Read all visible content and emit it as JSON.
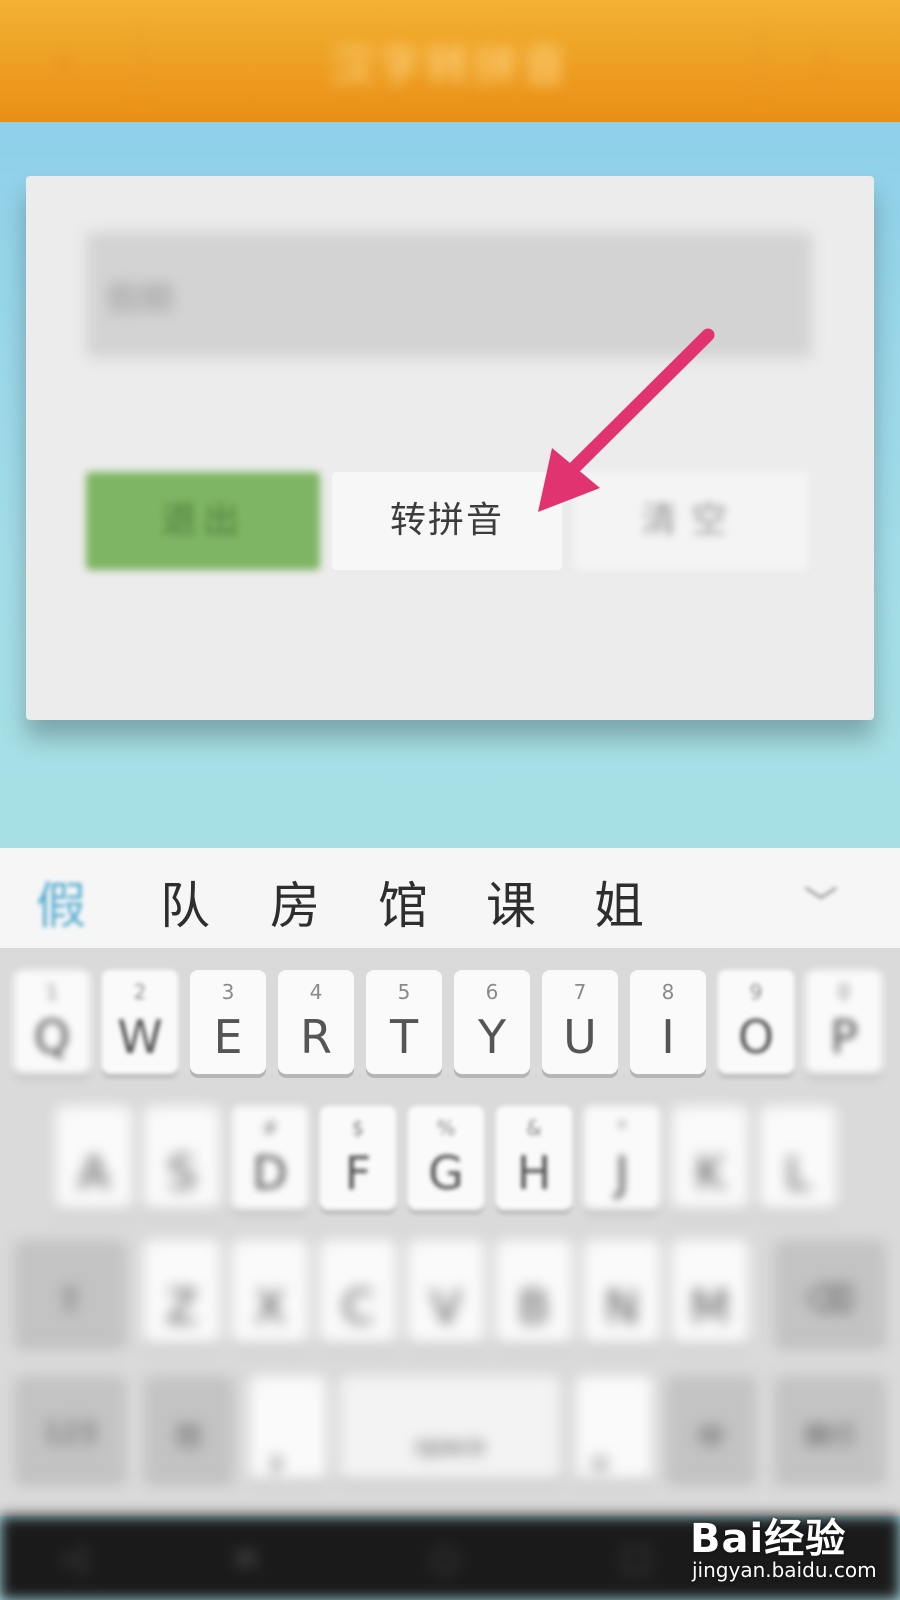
{
  "colors": {
    "topbar": "#ea8f15",
    "background": "#a9dde6",
    "exit_button": "#7db562",
    "arrow": "#e0336f",
    "candidate_highlight": "#5aaed1"
  },
  "app": {
    "title": "汉字转拼音",
    "back_icon": "back-arrow-icon",
    "menu_icon": "menu-icon"
  },
  "card": {
    "input_value": "假期",
    "buttons": {
      "exit": "退出",
      "to_pinyin": "转拼音",
      "clear": "清空"
    }
  },
  "ime": {
    "candidates": [
      "假",
      "队",
      "房",
      "馆",
      "课",
      "姐"
    ],
    "expand_icon": "chevron-down-icon"
  },
  "keyboard": {
    "row1": [
      {
        "num": "1",
        "letter": "Q"
      },
      {
        "num": "2",
        "letter": "W"
      },
      {
        "num": "3",
        "letter": "E"
      },
      {
        "num": "4",
        "letter": "R"
      },
      {
        "num": "5",
        "letter": "T"
      },
      {
        "num": "6",
        "letter": "Y"
      },
      {
        "num": "7",
        "letter": "U"
      },
      {
        "num": "8",
        "letter": "I"
      },
      {
        "num": "9",
        "letter": "O"
      },
      {
        "num": "0",
        "letter": "P"
      }
    ],
    "row2": [
      {
        "num": "",
        "letter": "A"
      },
      {
        "num": "",
        "letter": "S"
      },
      {
        "num": "#",
        "letter": "D"
      },
      {
        "num": "$",
        "letter": "F"
      },
      {
        "num": "%",
        "letter": "G"
      },
      {
        "num": "&",
        "letter": "H"
      },
      {
        "num": "*",
        "letter": "J"
      },
      {
        "num": "",
        "letter": "K"
      },
      {
        "num": "",
        "letter": "L"
      }
    ],
    "row3": [
      "Z",
      "X",
      "C",
      "V",
      "B",
      "N",
      "M"
    ],
    "row4": [
      "123",
      "符",
      "，",
      "space",
      "。",
      "中",
      "换行"
    ]
  },
  "watermark": {
    "logo": "Bai经验",
    "url": "jingyan.baidu.com"
  }
}
